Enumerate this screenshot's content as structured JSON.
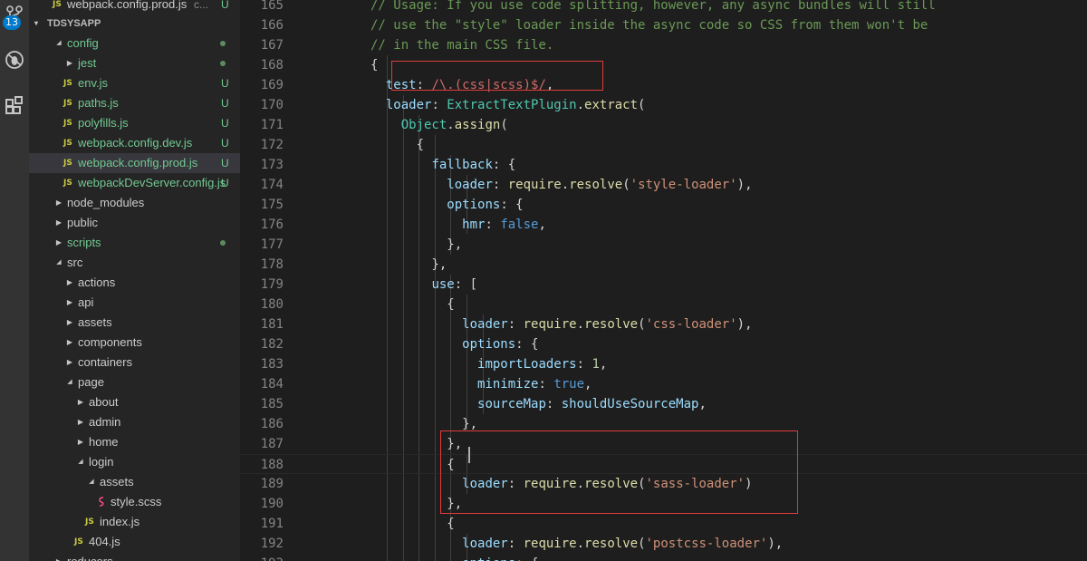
{
  "activity_bar": {
    "scm_badge": "13",
    "icons": [
      "source-control-icon",
      "debug-icon",
      "extensions-icon"
    ]
  },
  "explorer": {
    "section_title": "TDSYSAPP",
    "items": [
      {
        "label": "webpack.config.prod.js",
        "type": "file-js",
        "status": "U",
        "extra": "c..."
      },
      {
        "label": "config",
        "type": "folder-open",
        "status_dot": true,
        "green": true
      },
      {
        "label": "jest",
        "type": "folder",
        "status_dot": true,
        "green": true
      },
      {
        "label": "env.js",
        "type": "file-js",
        "status": "U",
        "green": true
      },
      {
        "label": "paths.js",
        "type": "file-js",
        "status": "U",
        "green": true
      },
      {
        "label": "polyfills.js",
        "type": "file-js",
        "status": "U",
        "green": true
      },
      {
        "label": "webpack.config.dev.js",
        "type": "file-js",
        "status": "U",
        "green": true
      },
      {
        "label": "webpack.config.prod.js",
        "type": "file-js",
        "status": "U",
        "green": true,
        "selected": true
      },
      {
        "label": "webpackDevServer.config.js",
        "type": "file-js",
        "status": "U",
        "green": true
      },
      {
        "label": "node_modules",
        "type": "folder"
      },
      {
        "label": "public",
        "type": "folder"
      },
      {
        "label": "scripts",
        "type": "folder",
        "status_dot": true,
        "green": true
      },
      {
        "label": "src",
        "type": "folder-open"
      },
      {
        "label": "actions",
        "type": "folder"
      },
      {
        "label": "api",
        "type": "folder"
      },
      {
        "label": "assets",
        "type": "folder"
      },
      {
        "label": "components",
        "type": "folder"
      },
      {
        "label": "containers",
        "type": "folder"
      },
      {
        "label": "page",
        "type": "folder-open"
      },
      {
        "label": "about",
        "type": "folder"
      },
      {
        "label": "admin",
        "type": "folder"
      },
      {
        "label": "home",
        "type": "folder"
      },
      {
        "label": "login",
        "type": "folder-open"
      },
      {
        "label": "assets",
        "type": "folder-open"
      },
      {
        "label": "style.scss",
        "type": "file-scss"
      },
      {
        "label": "index.js",
        "type": "file-js"
      },
      {
        "label": "404.js",
        "type": "file-js"
      },
      {
        "label": "reducers",
        "type": "folder"
      }
    ]
  },
  "editor": {
    "lines": [
      {
        "n": "165",
        "segs": [
          [
            "// Usage: If you use code splitting, however, any async bundles will still",
            "com"
          ]
        ]
      },
      {
        "n": "166",
        "segs": [
          [
            "// use the \"style\" loader inside the async code so CSS from them won't be",
            "com"
          ]
        ]
      },
      {
        "n": "167",
        "segs": [
          [
            "// in the main CSS file.",
            "com"
          ]
        ]
      },
      {
        "n": "168",
        "segs": [
          [
            "{",
            ""
          ]
        ]
      },
      {
        "n": "169",
        "segs": [
          [
            "  ",
            ""
          ],
          [
            "test",
            "prop"
          ],
          [
            ": ",
            ""
          ],
          [
            "/\\.(css|scss)$/",
            "re"
          ],
          [
            ",",
            ""
          ]
        ]
      },
      {
        "n": "170",
        "segs": [
          [
            "  ",
            ""
          ],
          [
            "loader",
            "prop"
          ],
          [
            ": ",
            ""
          ],
          [
            "ExtractTextPlugin",
            "cls"
          ],
          [
            ".",
            ""
          ],
          [
            "extract",
            "fn"
          ],
          [
            "(",
            ""
          ]
        ]
      },
      {
        "n": "171",
        "segs": [
          [
            "    ",
            ""
          ],
          [
            "Object",
            "cls"
          ],
          [
            ".",
            ""
          ],
          [
            "assign",
            "fn"
          ],
          [
            "(",
            ""
          ]
        ]
      },
      {
        "n": "172",
        "segs": [
          [
            "      {",
            ""
          ]
        ]
      },
      {
        "n": "173",
        "segs": [
          [
            "        ",
            ""
          ],
          [
            "fallback",
            "prop"
          ],
          [
            ": {",
            ""
          ]
        ]
      },
      {
        "n": "174",
        "segs": [
          [
            "          ",
            ""
          ],
          [
            "loader",
            "prop"
          ],
          [
            ": ",
            ""
          ],
          [
            "require",
            "fn"
          ],
          [
            ".",
            ""
          ],
          [
            "resolve",
            "fn"
          ],
          [
            "(",
            ""
          ],
          [
            "'style-loader'",
            "str"
          ],
          [
            "),",
            ""
          ]
        ]
      },
      {
        "n": "175",
        "segs": [
          [
            "          ",
            ""
          ],
          [
            "options",
            "prop"
          ],
          [
            ": {",
            ""
          ]
        ]
      },
      {
        "n": "176",
        "segs": [
          [
            "            ",
            ""
          ],
          [
            "hmr",
            "prop"
          ],
          [
            ": ",
            ""
          ],
          [
            "false",
            "kw"
          ],
          [
            ",",
            ""
          ]
        ]
      },
      {
        "n": "177",
        "segs": [
          [
            "          },",
            ""
          ]
        ]
      },
      {
        "n": "178",
        "segs": [
          [
            "        },",
            ""
          ]
        ]
      },
      {
        "n": "179",
        "segs": [
          [
            "        ",
            ""
          ],
          [
            "use",
            "prop"
          ],
          [
            ": [",
            ""
          ]
        ]
      },
      {
        "n": "180",
        "segs": [
          [
            "          {",
            ""
          ]
        ]
      },
      {
        "n": "181",
        "segs": [
          [
            "            ",
            ""
          ],
          [
            "loader",
            "prop"
          ],
          [
            ": ",
            ""
          ],
          [
            "require",
            "fn"
          ],
          [
            ".",
            ""
          ],
          [
            "resolve",
            "fn"
          ],
          [
            "(",
            ""
          ],
          [
            "'css-loader'",
            "str"
          ],
          [
            "),",
            ""
          ]
        ]
      },
      {
        "n": "182",
        "segs": [
          [
            "            ",
            ""
          ],
          [
            "options",
            "prop"
          ],
          [
            ": {",
            ""
          ]
        ]
      },
      {
        "n": "183",
        "segs": [
          [
            "              ",
            ""
          ],
          [
            "importLoaders",
            "prop"
          ],
          [
            ": ",
            ""
          ],
          [
            "1",
            "num"
          ],
          [
            ",",
            ""
          ]
        ]
      },
      {
        "n": "184",
        "segs": [
          [
            "              ",
            ""
          ],
          [
            "minimize",
            "prop"
          ],
          [
            ": ",
            ""
          ],
          [
            "true",
            "kw"
          ],
          [
            ",",
            ""
          ]
        ]
      },
      {
        "n": "185",
        "segs": [
          [
            "              ",
            ""
          ],
          [
            "sourceMap",
            "prop"
          ],
          [
            ": ",
            ""
          ],
          [
            "shouldUseSourceMap",
            "prop"
          ],
          [
            ",",
            ""
          ]
        ]
      },
      {
        "n": "186",
        "segs": [
          [
            "            },",
            ""
          ]
        ]
      },
      {
        "n": "187",
        "segs": [
          [
            "          },",
            ""
          ]
        ]
      },
      {
        "n": "188",
        "segs": [
          [
            "          {",
            ""
          ]
        ],
        "current": true
      },
      {
        "n": "189",
        "segs": [
          [
            "            ",
            ""
          ],
          [
            "loader",
            "prop"
          ],
          [
            ": ",
            ""
          ],
          [
            "require",
            "fn"
          ],
          [
            ".",
            ""
          ],
          [
            "resolve",
            "fn"
          ],
          [
            "(",
            ""
          ],
          [
            "'sass-loader'",
            "str"
          ],
          [
            ")",
            ""
          ]
        ]
      },
      {
        "n": "190",
        "segs": [
          [
            "          },",
            ""
          ]
        ]
      },
      {
        "n": "191",
        "segs": [
          [
            "          {",
            ""
          ]
        ]
      },
      {
        "n": "192",
        "segs": [
          [
            "            ",
            ""
          ],
          [
            "loader",
            "prop"
          ],
          [
            ": ",
            ""
          ],
          [
            "require",
            "fn"
          ],
          [
            ".",
            ""
          ],
          [
            "resolve",
            "fn"
          ],
          [
            "(",
            ""
          ],
          [
            "'postcss-loader'",
            "str"
          ],
          [
            "),",
            ""
          ]
        ]
      },
      {
        "n": "193",
        "segs": [
          [
            "            ",
            ""
          ],
          [
            "options",
            "prop"
          ],
          [
            ": {",
            ""
          ]
        ]
      }
    ]
  }
}
